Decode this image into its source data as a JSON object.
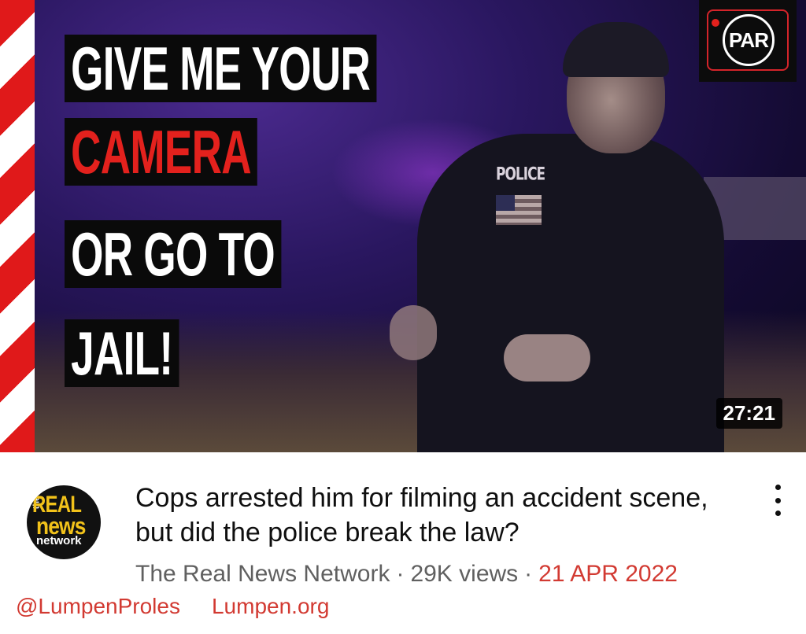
{
  "thumbnail": {
    "headline_lines": [
      {
        "text": "GIVE ME YOUR",
        "color": "#ffffff"
      },
      {
        "text": "CAMERA",
        "color": "#e3211d"
      },
      {
        "text": "OR GO TO",
        "color": "#ffffff"
      },
      {
        "text": "JAIL!",
        "color": "#ffffff"
      }
    ],
    "patch_text": "POLICE",
    "logo_text": "PAR",
    "duration": "27:21"
  },
  "channel_avatar": {
    "line_the": "the",
    "line1": "REAL",
    "line2": "news",
    "line3": "network"
  },
  "video": {
    "title": "Cops arrested him for filming an accident scene, but did the police break the law?",
    "channel": "The Real News Network",
    "separator": "·",
    "views": "29K views",
    "date": "21 APR 2022"
  },
  "credits": {
    "handle": "@LumpenProles",
    "site": "Lumpen.org"
  },
  "colors": {
    "accent_red": "#d23a32",
    "meta_gray": "#606060"
  }
}
